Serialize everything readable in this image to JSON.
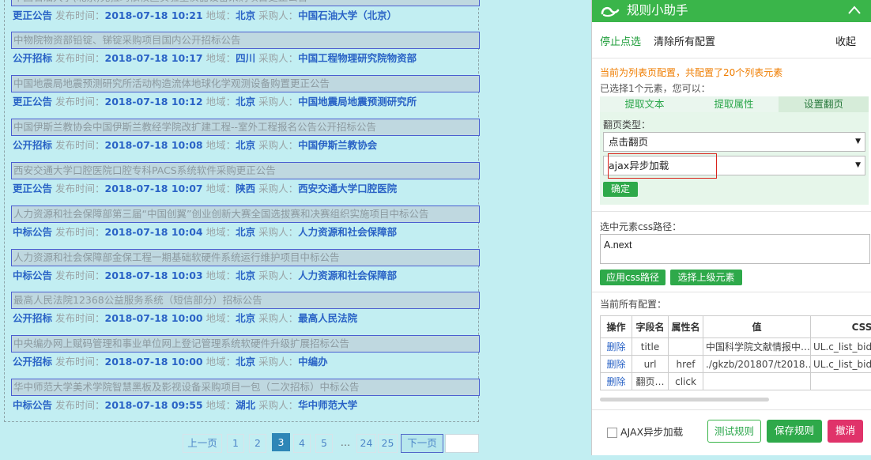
{
  "listings": [
    {
      "title": "中国石油大学(北京)克拉玛依校区实验室仪器设备采购项目更正公告",
      "type": "更正公告",
      "date_label": "发布时间：",
      "date": "2018-07-18 10:21",
      "region_label": "地域：",
      "region": "北京",
      "buyer_label": "采购人：",
      "buyer": "中国石油大学（北京）"
    },
    {
      "title": "中物院物资部铅锭、锑锭采购项目国内公开招标公告",
      "type": "公开招标",
      "date_label": "发布时间：",
      "date": "2018-07-18 10:17",
      "region_label": "地域：",
      "region": "四川",
      "buyer_label": "采购人：",
      "buyer": "中国工程物理研究院物资部"
    },
    {
      "title": "中国地震局地震预测研究所活动构造流体地球化学观测设备购置更正公告",
      "type": "更正公告",
      "date_label": "发布时间：",
      "date": "2018-07-18 10:12",
      "region_label": "地域：",
      "region": "北京",
      "buyer_label": "采购人：",
      "buyer": "中国地震局地震预测研究所"
    },
    {
      "title": "中国伊斯兰教协会中国伊斯兰教经学院改扩建工程--室外工程报名公告公开招标公告",
      "type": "公开招标",
      "date_label": "发布时间：",
      "date": "2018-07-18 10:08",
      "region_label": "地域：",
      "region": "北京",
      "buyer_label": "采购人：",
      "buyer": "中国伊斯兰教协会"
    },
    {
      "title": "西安交通大学口腔医院口腔专科PACS系统软件采购更正公告",
      "type": "更正公告",
      "date_label": "发布时间：",
      "date": "2018-07-18 10:07",
      "region_label": "地域：",
      "region": "陕西",
      "buyer_label": "采购人：",
      "buyer": "西安交通大学口腔医院"
    },
    {
      "title": "人力资源和社会保障部第三届“中国创翼”创业创新大赛全国选拔赛和决赛组织实施项目中标公告",
      "type": "中标公告",
      "date_label": "发布时间：",
      "date": "2018-07-18 10:04",
      "region_label": "地域：",
      "region": "北京",
      "buyer_label": "采购人：",
      "buyer": "人力资源和社会保障部"
    },
    {
      "title": "人力资源和社会保障部金保工程一期基础软硬件系统运行维护项目中标公告",
      "type": "中标公告",
      "date_label": "发布时间：",
      "date": "2018-07-18 10:03",
      "region_label": "地域：",
      "region": "北京",
      "buyer_label": "采购人：",
      "buyer": "人力资源和社会保障部"
    },
    {
      "title": "最高人民法院12368公益服务系统（短信部分）招标公告",
      "type": "公开招标",
      "date_label": "发布时间：",
      "date": "2018-07-18 10:00",
      "region_label": "地域：",
      "region": "北京",
      "buyer_label": "采购人：",
      "buyer": "最高人民法院"
    },
    {
      "title": "中央编办网上赋码管理和事业单位网上登记管理系统软硬件升级扩展招标公告",
      "type": "公开招标",
      "date_label": "发布时间：",
      "date": "2018-07-18 10:00",
      "region_label": "地域：",
      "region": "北京",
      "buyer_label": "采购人：",
      "buyer": "中编办"
    },
    {
      "title": "华中师范大学美术学院智慧黑板及影视设备采购项目一包（二次招标）中标公告",
      "type": "中标公告",
      "date_label": "发布时间：",
      "date": "2018-07-18 09:55",
      "region_label": "地域：",
      "region": "湖北",
      "buyer_label": "采购人：",
      "buyer": "华中师范大学"
    }
  ],
  "pagination": {
    "prev": "上一页",
    "pages": [
      "1",
      "2",
      "3",
      "4",
      "5"
    ],
    "current": "3",
    "ellipsis": "…",
    "tail_pages": [
      "24",
      "25"
    ],
    "next": "下一页",
    "jump_value": ""
  },
  "panel": {
    "title": "规则小助手",
    "stop_select": "停止点选",
    "clear_config": "清除所有配置",
    "fold": "收起",
    "config_note": "当前为列表页配置，共配置了20个列表元素",
    "selected_note": "已选择1个元素，您可以：",
    "tabs": [
      "提取文本",
      "提取属性",
      "设置翻页"
    ],
    "active_tab": "设置翻页",
    "page_type_label": "翻页类型：",
    "page_type_value": "点击翻页",
    "load_type_value": "ajax异步加载",
    "confirm": "确定",
    "css_path_label": "选中元素css路径：",
    "css_path_value": "A.next",
    "apply_css": "应用css路径",
    "select_parent": "选择上级元素",
    "all_config_label": "当前所有配置：",
    "table": {
      "headers": [
        "操作",
        "字段名",
        "属性名",
        "值",
        "CSS路径"
      ],
      "rows": [
        {
          "op": "删除",
          "field": "title",
          "attr": "",
          "value": "中国科学院文献情报中…",
          "css": "UL.c_list_bid>LI>A"
        },
        {
          "op": "删除",
          "field": "url",
          "attr": "href",
          "value": "./gkzb/201807/t2018…",
          "css": "UL.c_list_bid>LI>A"
        },
        {
          "op": "删除",
          "field": "翻页…",
          "attr": "click",
          "value": "",
          "css": ""
        }
      ]
    },
    "ajax_checkbox_label": "AJAX异步加载",
    "test_rule": "测试规则",
    "save_rule": "保存规则",
    "cancel": "撤消"
  },
  "colors": {
    "accent_green": "#3ab54a",
    "link_blue": "#2a63c6",
    "warning_orange": "#ef7d00",
    "danger_pink": "#e0336a",
    "page_background": "#c2eef2"
  }
}
